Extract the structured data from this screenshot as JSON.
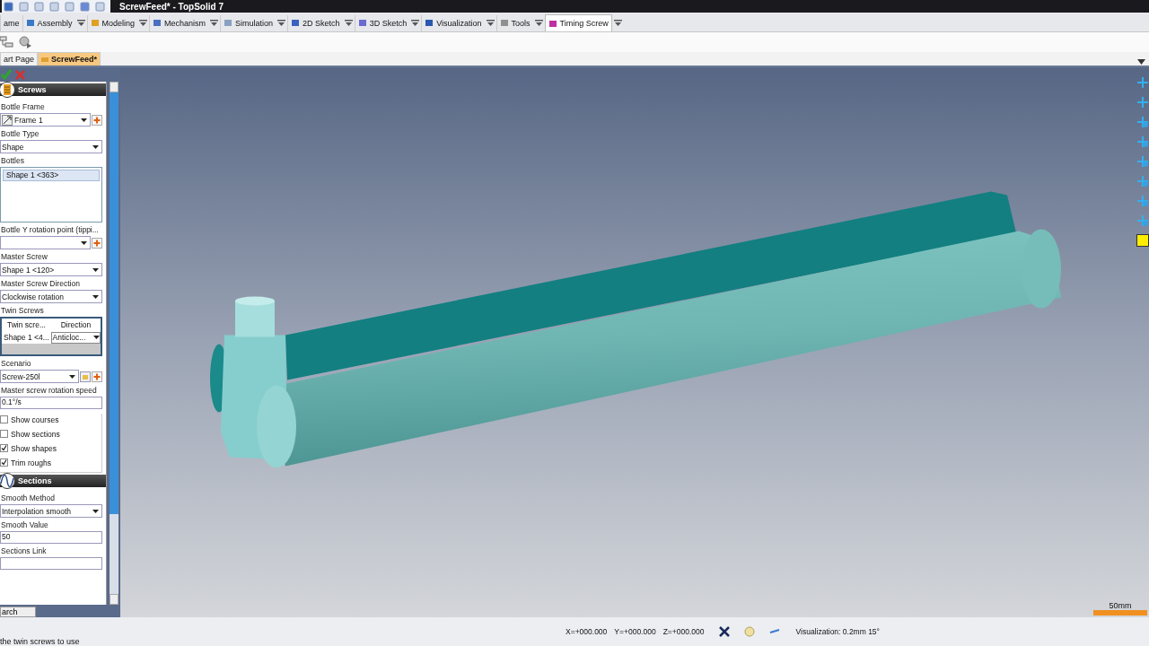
{
  "window": {
    "title": "ScrewFeed* - TopSolid 7"
  },
  "ribbon_tabs": [
    {
      "label": "ame",
      "selected": false
    },
    {
      "label": "Assembly",
      "selected": false
    },
    {
      "label": "Modeling",
      "selected": false
    },
    {
      "label": "Mechanism",
      "selected": false
    },
    {
      "label": "Simulation",
      "selected": false
    },
    {
      "label": "2D Sketch",
      "selected": false
    },
    {
      "label": "3D Sketch",
      "selected": false
    },
    {
      "label": "Visualization",
      "selected": false
    },
    {
      "label": "Tools",
      "selected": false
    },
    {
      "label": "Timing Screw",
      "selected": true
    }
  ],
  "document_tabs": [
    {
      "label": "art Page",
      "selected": false
    },
    {
      "label": "ScrewFeed*",
      "selected": true
    }
  ],
  "panel": {
    "sections": [
      {
        "title": "Screws",
        "kind": "screws",
        "items": [
          {
            "kind": "select",
            "label": "Bottle Frame",
            "value": "Frame 1",
            "frame_icon": true,
            "add_button": true
          },
          {
            "kind": "select",
            "label": "Bottle Type",
            "value": "Shape"
          },
          {
            "kind": "list",
            "label": "Bottles",
            "entries": [
              {
                "text": "Shape 1 <363>",
                "selected": true
              }
            ]
          },
          {
            "kind": "select",
            "label": "Bottle Y rotation point (tippi...",
            "value": "",
            "add_button": true
          },
          {
            "kind": "select",
            "label": "Master Screw",
            "value": "Shape 1 <120>"
          },
          {
            "kind": "select",
            "label": "Master Screw Direction",
            "value": "Clockwise rotation"
          },
          {
            "kind": "table",
            "label": "Twin Screws",
            "columns": [
              "Twin scre...",
              "Direction"
            ],
            "rows": [
              [
                "Shape 1 <4...",
                "Anticloc..."
              ]
            ]
          },
          {
            "kind": "select",
            "label": "Scenario",
            "value": "Screw-250l",
            "browse_button": true,
            "add_button": true
          },
          {
            "kind": "text",
            "label": "Master screw rotation speed",
            "value": "0.1°/s"
          },
          {
            "kind": "checks",
            "options": [
              {
                "label": "Show courses",
                "checked": false
              },
              {
                "label": "Show sections",
                "checked": false
              },
              {
                "label": "Show shapes",
                "checked": true
              },
              {
                "label": "Trim roughs",
                "checked": true
              }
            ]
          }
        ]
      },
      {
        "title": "Sections",
        "kind": "sections",
        "items": [
          {
            "kind": "select",
            "label": "Smooth Method",
            "value": "Interpolation smooth"
          },
          {
            "kind": "text",
            "label": "Smooth Value",
            "value": "50"
          },
          {
            "kind": "text",
            "label": "Sections Link",
            "value": ""
          }
        ]
      }
    ]
  },
  "viewport": {
    "scale_label": "50mm"
  },
  "status_bar": {
    "button": "arch",
    "hint": "the twin screws to use",
    "coordinates": [
      "X=+000.000",
      "Y=+000.000",
      "Z=+000.000"
    ],
    "visualization": "Visualization: 0.2mm 15°"
  }
}
